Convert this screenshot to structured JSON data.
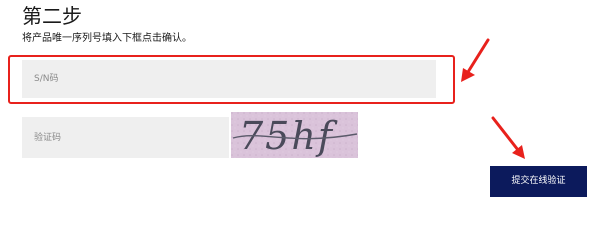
{
  "step": {
    "title": "第二步",
    "instruction": "将产品唯一序列号填入下框点击确认。"
  },
  "form": {
    "sn_placeholder": "S/N码",
    "captcha_placeholder": "验证码",
    "captcha_text": "75hf",
    "submit_label": "提交在线验证"
  },
  "annotation": {
    "accent_color": "#e8211c"
  },
  "colors": {
    "field_background": "#efefef",
    "button_background": "#0c1a5c",
    "button_text": "#ffffff"
  }
}
